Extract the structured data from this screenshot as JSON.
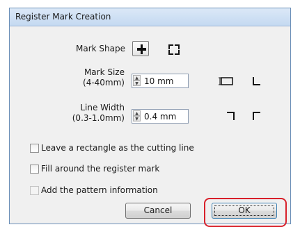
{
  "window": {
    "title": "Register Mark Creation"
  },
  "mark_shape": {
    "label": "Mark Shape",
    "selected": "inner-corners"
  },
  "mark_size": {
    "label_line1": "Mark Size",
    "label_line2": "(4-40mm)",
    "value": "10 mm"
  },
  "line_width": {
    "label_line1": "Line Width",
    "label_line2": "(0.3-1.0mm)",
    "value": "0.4 mm"
  },
  "options": [
    {
      "label": "Leave a rectangle as the cutting line",
      "checked": false,
      "enabled": true
    },
    {
      "label": "Fill around the register mark",
      "checked": false,
      "enabled": true
    },
    {
      "label": "Add the pattern information",
      "checked": false,
      "enabled": false
    }
  ],
  "buttons": {
    "cancel": "Cancel",
    "ok": "OK"
  },
  "colors": {
    "highlight": "#d8202a",
    "titlebar": "#c4d9f1"
  }
}
